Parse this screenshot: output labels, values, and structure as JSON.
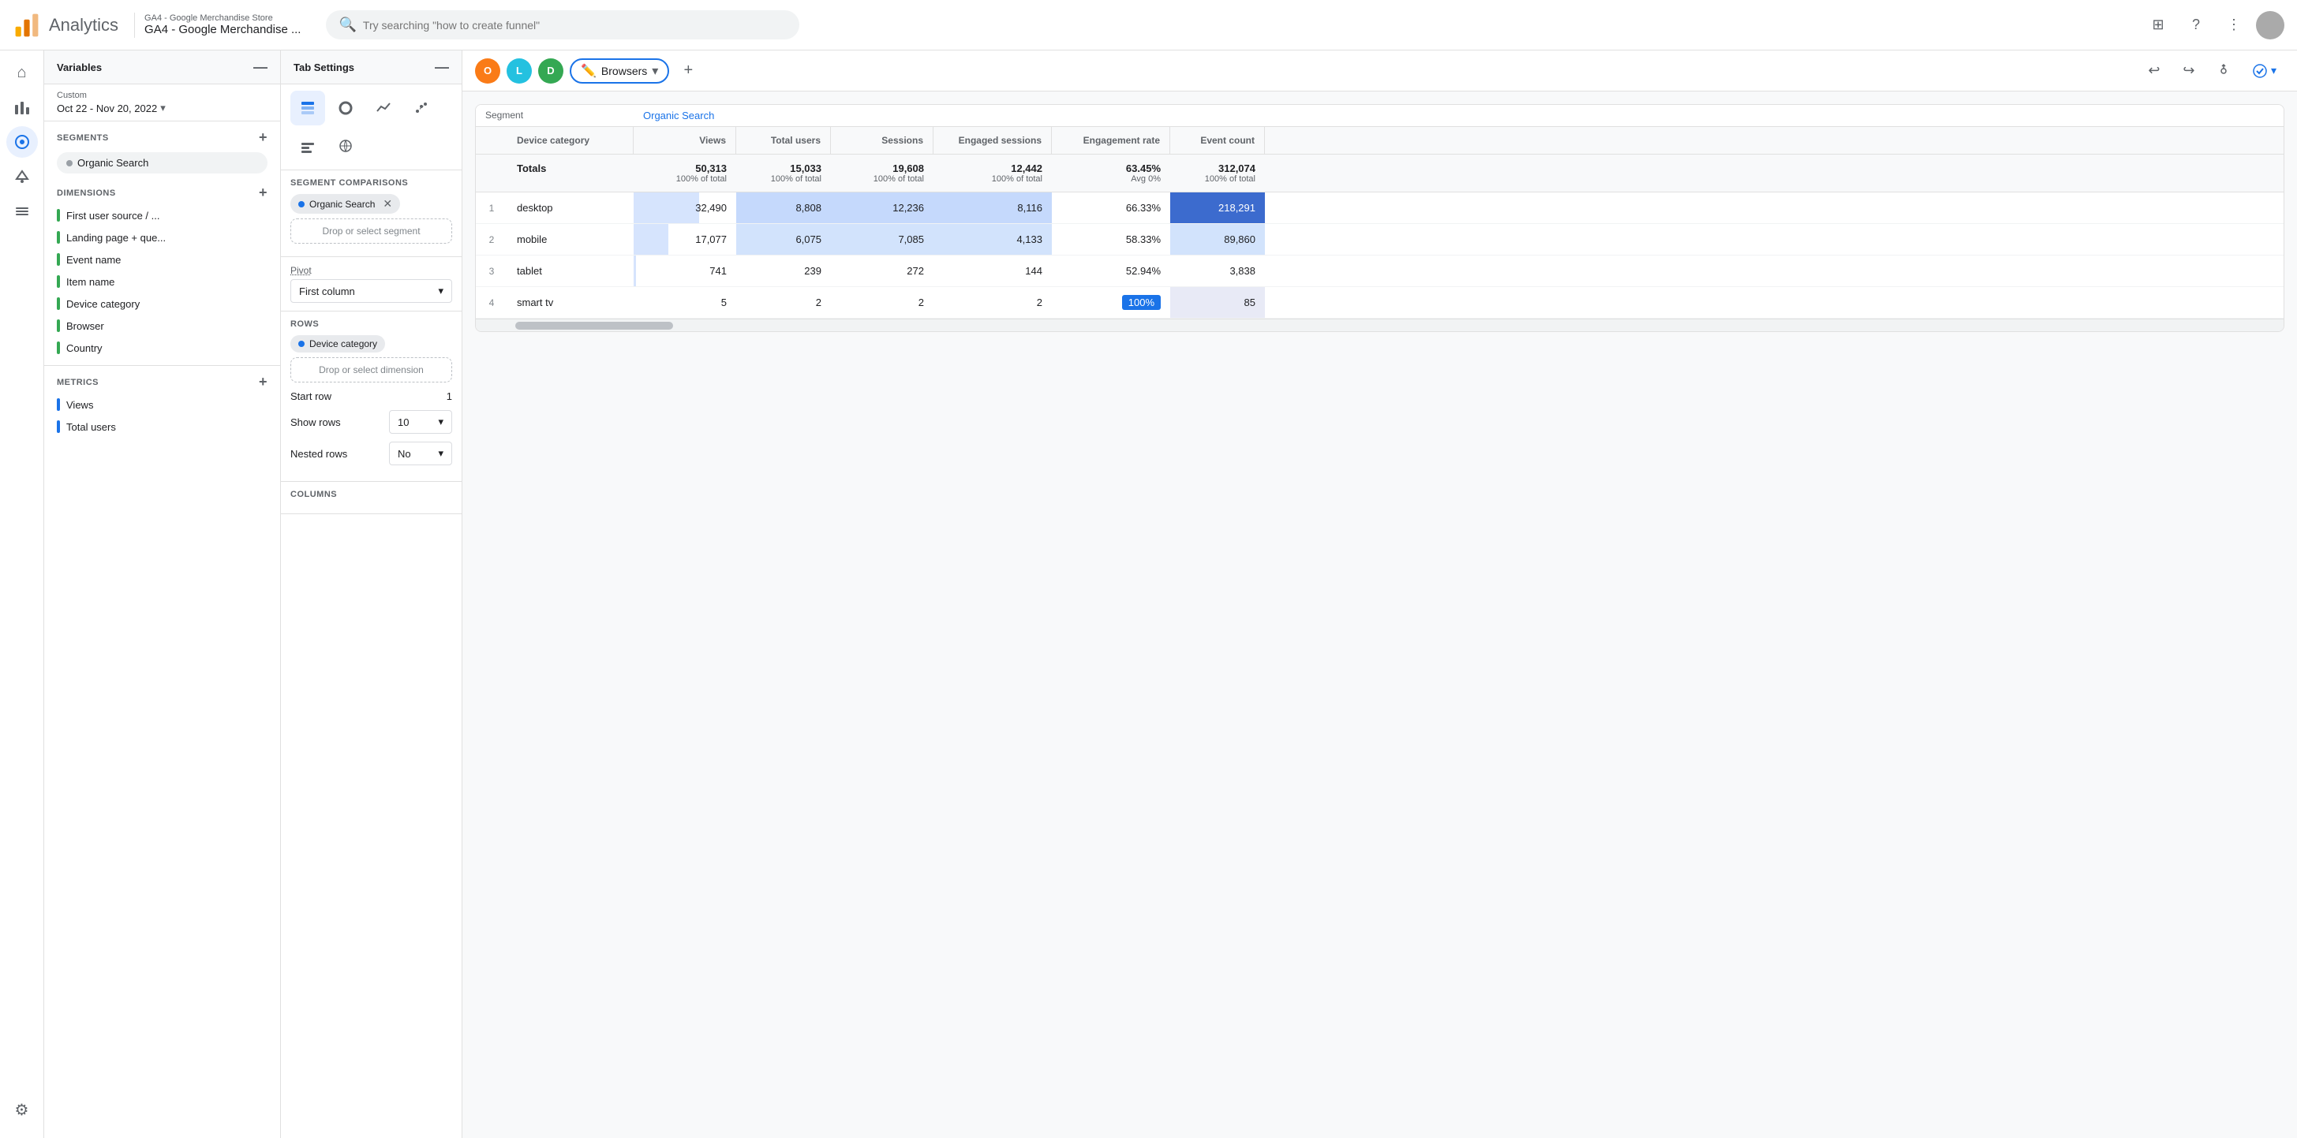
{
  "topbar": {
    "app_name": "Analytics",
    "account_sub": "GA4 - Google Merchandise Store",
    "account_main": "GA4 - Google Merchandise ...",
    "search_placeholder": "Try searching \"how to create funnel\"",
    "grid_icon": "⊞",
    "help_icon": "?",
    "more_icon": "⋮"
  },
  "sidenav": {
    "items": [
      {
        "name": "home",
        "icon": "⌂",
        "active": false
      },
      {
        "name": "reports",
        "icon": "📊",
        "active": false
      },
      {
        "name": "explore",
        "icon": "🔍",
        "active": true
      },
      {
        "name": "advertising",
        "icon": "📣",
        "active": false
      },
      {
        "name": "configure",
        "icon": "⚙",
        "active": false
      }
    ],
    "bottom_icon": "⚙"
  },
  "variables_panel": {
    "title": "Variables",
    "minimize": "—",
    "date": {
      "label": "Custom",
      "range": "Oct 22 - Nov 20, 2022"
    },
    "segments": {
      "title": "SEGMENTS",
      "items": [
        {
          "name": "Organic Search"
        }
      ]
    },
    "dimensions": {
      "title": "DIMENSIONS",
      "items": [
        {
          "name": "First user source / ...",
          "color": "green"
        },
        {
          "name": "Landing page + que...",
          "color": "green"
        },
        {
          "name": "Event name",
          "color": "green"
        },
        {
          "name": "Item name",
          "color": "green"
        },
        {
          "name": "Device category",
          "color": "green"
        },
        {
          "name": "Browser",
          "color": "green"
        },
        {
          "name": "Country",
          "color": "green"
        }
      ]
    },
    "metrics": {
      "title": "METRICS",
      "items": [
        {
          "name": "Views",
          "color": "blue"
        },
        {
          "name": "Total users",
          "color": "blue"
        }
      ]
    }
  },
  "tab_settings": {
    "title": "Tab Settings",
    "minimize": "—",
    "tab_icons": [
      {
        "name": "table-view",
        "icon": "⊞",
        "active": true
      },
      {
        "name": "donut-view",
        "icon": "◎",
        "active": false
      },
      {
        "name": "line-view",
        "icon": "📈",
        "active": false
      },
      {
        "name": "scatter-view",
        "icon": "⊕",
        "active": false
      },
      {
        "name": "bar-view",
        "icon": "≡",
        "active": false
      },
      {
        "name": "map-view",
        "icon": "🌍",
        "active": false
      }
    ],
    "segment_comparisons": {
      "title": "SEGMENT COMPARISONS",
      "chips": [
        {
          "name": "Organic Search"
        }
      ],
      "drop_label": "Drop or select segment"
    },
    "pivot": {
      "label": "Pivot",
      "selected": "First column"
    },
    "rows": {
      "title": "ROWS",
      "dimension": "Device category",
      "drop_label": "Drop or select dimension",
      "start_row_label": "Start row",
      "start_row_value": "1",
      "show_rows_label": "Show rows",
      "show_rows_value": "10",
      "nested_rows_label": "Nested rows",
      "nested_rows_value": "No"
    },
    "columns_title": "COLUMNS"
  },
  "tabs_bar": {
    "tabs": [
      {
        "id": "O",
        "bg": "orange"
      },
      {
        "id": "L",
        "bg": "teal"
      },
      {
        "id": "D",
        "bg": "green"
      }
    ],
    "active_tab": "Browsers",
    "add_tab": "+",
    "undo_icon": "↩",
    "redo_icon": "↪",
    "share_icon": "👤+",
    "publish_icon": "✓",
    "publish_dropdown": "▾",
    "more_icon": "▾"
  },
  "table": {
    "segment_row": {
      "segment_label": "Segment",
      "segment_value": "Organic Search"
    },
    "headers": {
      "device_category": "Device category",
      "views": "Views",
      "total_users": "Total users",
      "sessions": "Sessions",
      "engaged_sessions": "Engaged sessions",
      "engagement_rate": "Engagement rate",
      "event_count": "Event count"
    },
    "totals": {
      "label": "Totals",
      "views": "50,313",
      "views_pct": "100% of total",
      "total_users": "15,033",
      "total_users_pct": "100% of total",
      "sessions": "19,608",
      "sessions_pct": "100% of total",
      "engaged_sessions": "12,442",
      "engaged_sessions_pct": "100% of total",
      "engagement_rate": "63.45%",
      "engagement_rate_pct": "Avg 0%",
      "event_count": "312,074",
      "event_count_pct": "100% of total"
    },
    "rows": [
      {
        "num": "1",
        "device": "desktop",
        "views": "32,490",
        "views_bar": 64,
        "total_users": "8,808",
        "sessions": "12,236",
        "engaged_sessions": "8,116",
        "engagement_rate": "66.33%",
        "event_count": "218,291",
        "highlight": "strong"
      },
      {
        "num": "2",
        "device": "mobile",
        "views": "17,077",
        "views_bar": 34,
        "total_users": "6,075",
        "sessions": "7,085",
        "engaged_sessions": "4,133",
        "engagement_rate": "58.33%",
        "event_count": "89,860",
        "highlight": "medium"
      },
      {
        "num": "3",
        "device": "tablet",
        "views": "741",
        "views_bar": 2,
        "total_users": "239",
        "sessions": "272",
        "engaged_sessions": "144",
        "engagement_rate": "52.94%",
        "event_count": "3,838",
        "highlight": "light"
      },
      {
        "num": "4",
        "device": "smart tv",
        "views": "5",
        "views_bar": 0,
        "total_users": "2",
        "sessions": "2",
        "engaged_sessions": "2",
        "engagement_rate": "100%",
        "event_count": "85",
        "highlight": "none"
      }
    ]
  }
}
